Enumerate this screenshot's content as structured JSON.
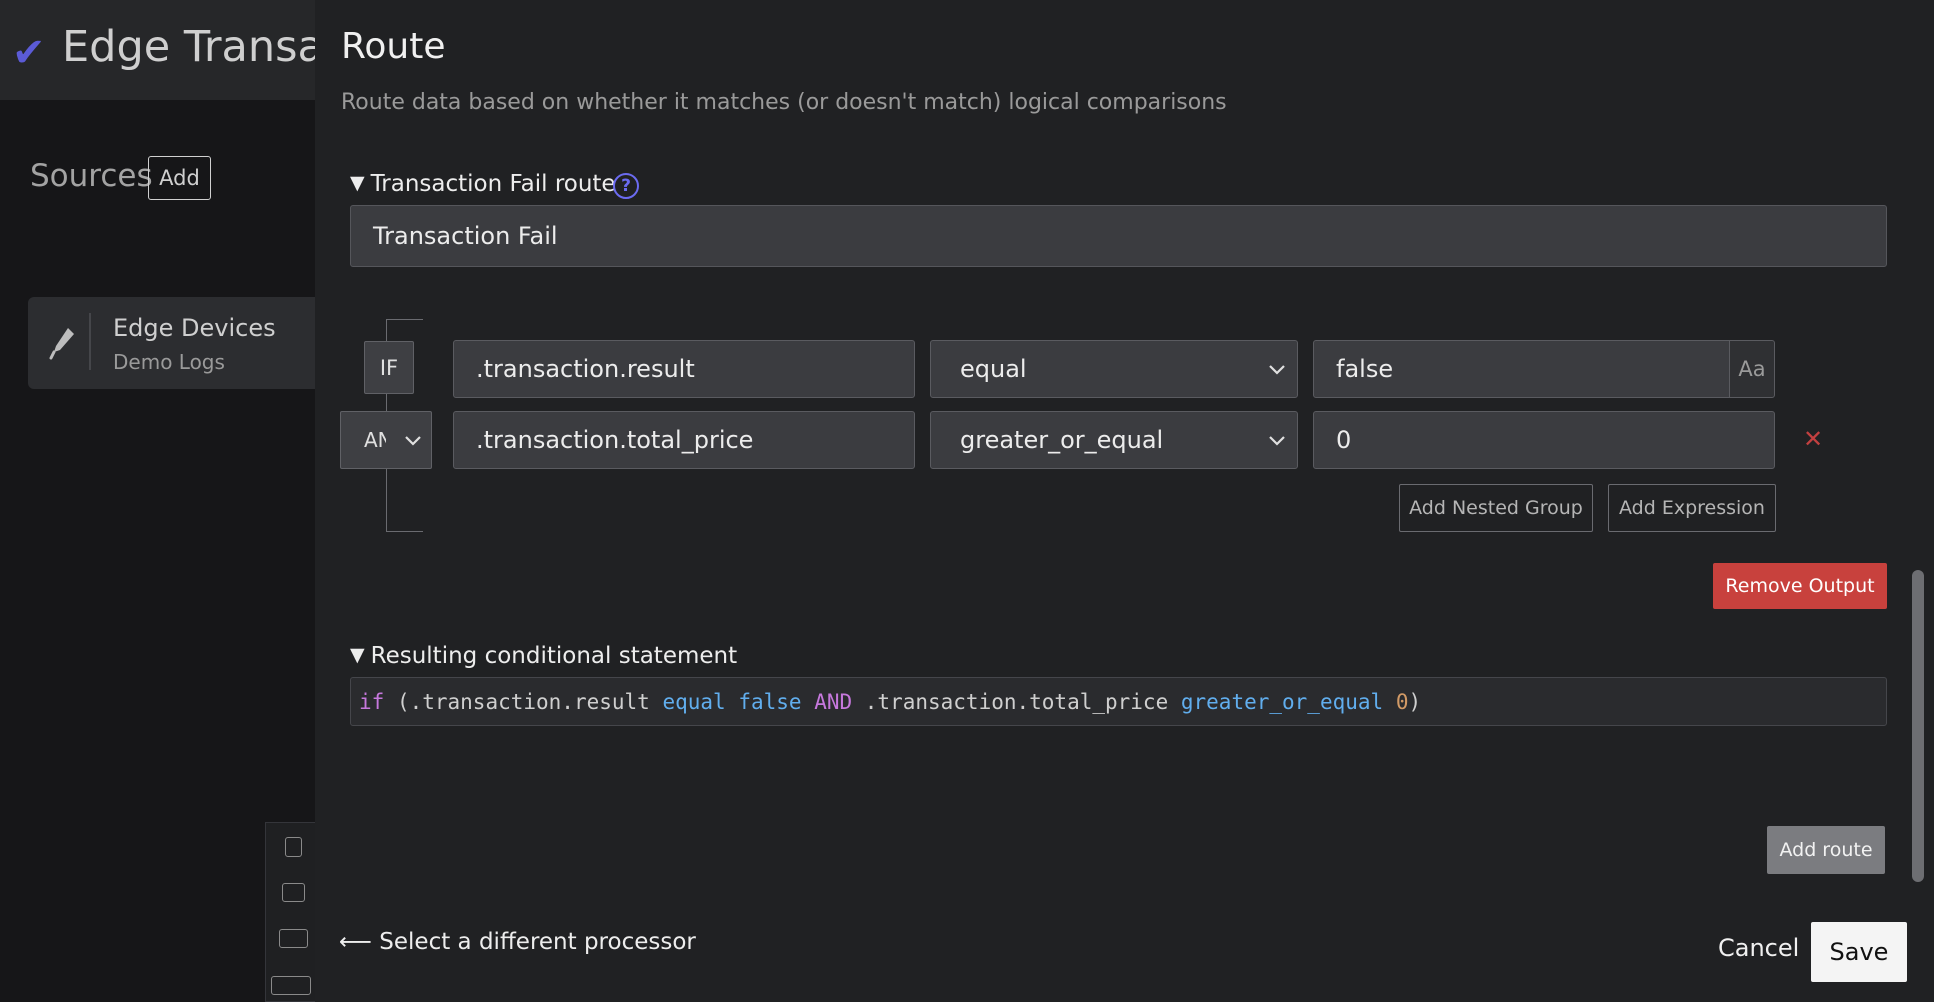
{
  "background": {
    "app_title": "Edge Transact",
    "sources_label": "Sources",
    "add_label": "Add",
    "source_card": {
      "title": "Edge Devices",
      "subtitle": "Demo Logs"
    }
  },
  "drawer": {
    "title": "Route",
    "description": "Route data based on whether it matches (or doesn't match) logical comparisons",
    "route_section": {
      "heading": "Transaction Fail route",
      "name_value": "Transaction Fail"
    },
    "conditions": {
      "if_label": "IF",
      "and_label": "AND",
      "rows": [
        {
          "field": ".transaction.result",
          "operator": "equal",
          "value": "false",
          "case_toggle": "Aa"
        },
        {
          "field": ".transaction.total_price",
          "operator": "greater_or_equal",
          "value": "0"
        }
      ],
      "add_nested_group": "Add Nested Group",
      "add_expression": "Add Expression",
      "remove_output": "Remove Output"
    },
    "result_section": {
      "heading": "Resulting conditional statement",
      "code": {
        "p1": "if",
        "p2": " (.transaction.result ",
        "p3": "equal",
        "p4": " ",
        "p5": "false",
        "p6": " ",
        "p7": "AND",
        "p8": " .transaction.total_price ",
        "p9": "greater_or_equal",
        "p10": " ",
        "p11": "0",
        "p12": ")"
      }
    },
    "add_route": "Add route",
    "back_link": "⟵ Select a different processor",
    "cancel": "Cancel",
    "save": "Save"
  }
}
